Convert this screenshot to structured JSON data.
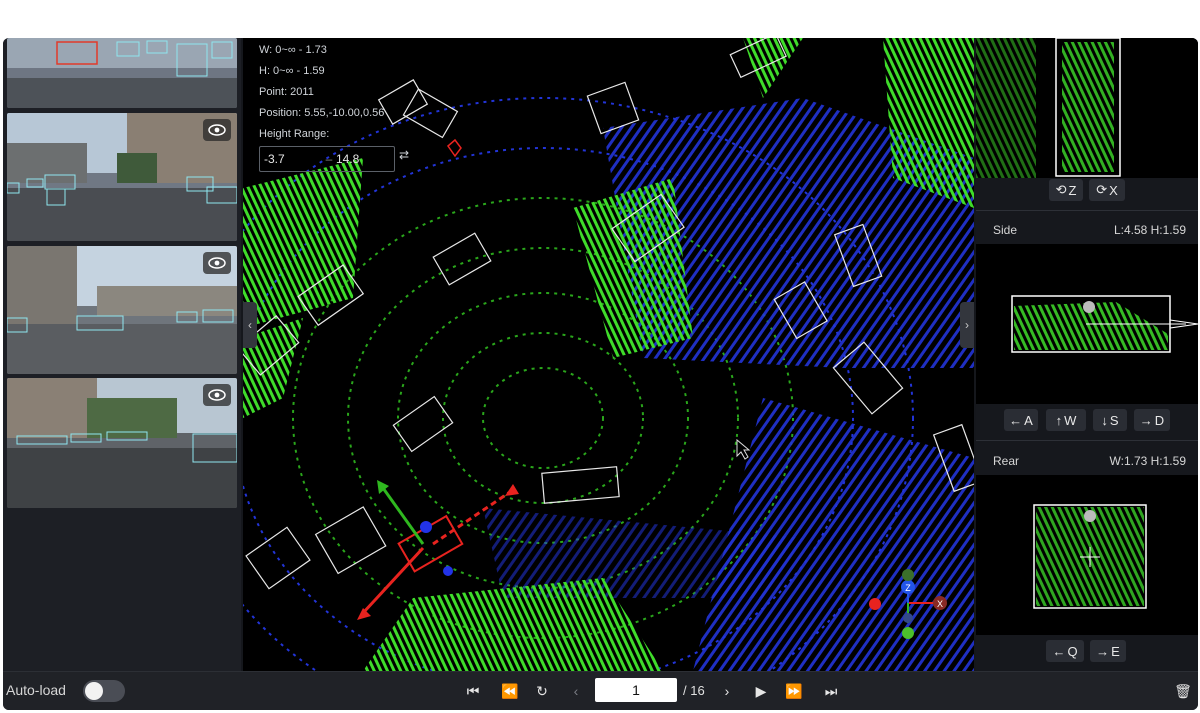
{
  "hud": {
    "w": "W: 0~∞ - 1.73",
    "h": "H: 0~∞ - 1.59",
    "point": "Point: 2011",
    "position": "Position: 5.55,-10.00,0.56",
    "height_range_label": "Height Range:",
    "height_min": "-3.7",
    "height_max": "14.8"
  },
  "right_panel": {
    "top_buttons": [
      "Z",
      "X"
    ],
    "side": {
      "title": "Side",
      "dims": "L:4.58 H:1.59"
    },
    "side_buttons": [
      "A",
      "W",
      "S",
      "D"
    ],
    "rear": {
      "title": "Rear",
      "dims": "W:1.73 H:1.59"
    },
    "rear_buttons": [
      "Q",
      "E"
    ]
  },
  "bottom": {
    "autoload_label": "Auto-load",
    "autoload_on": false,
    "frame_current": "1",
    "frame_total": "/ 16"
  },
  "icons": [
    "eye-icon",
    "chevron-left-icon",
    "chevron-right-icon",
    "first-frame-icon",
    "rewind-icon",
    "replay-icon",
    "prev-icon",
    "next-icon",
    "play-icon",
    "fast-forward-icon",
    "last-frame-icon",
    "trash-icon"
  ],
  "colors": {
    "background": "#15171c",
    "point_cloud_green": "#3fdc2a",
    "point_cloud_blue": "#1f2fd0",
    "box_white": "#e8e8e8",
    "selected_red": "#e8231f",
    "camera_box_cyan": "#7fe3ee"
  }
}
